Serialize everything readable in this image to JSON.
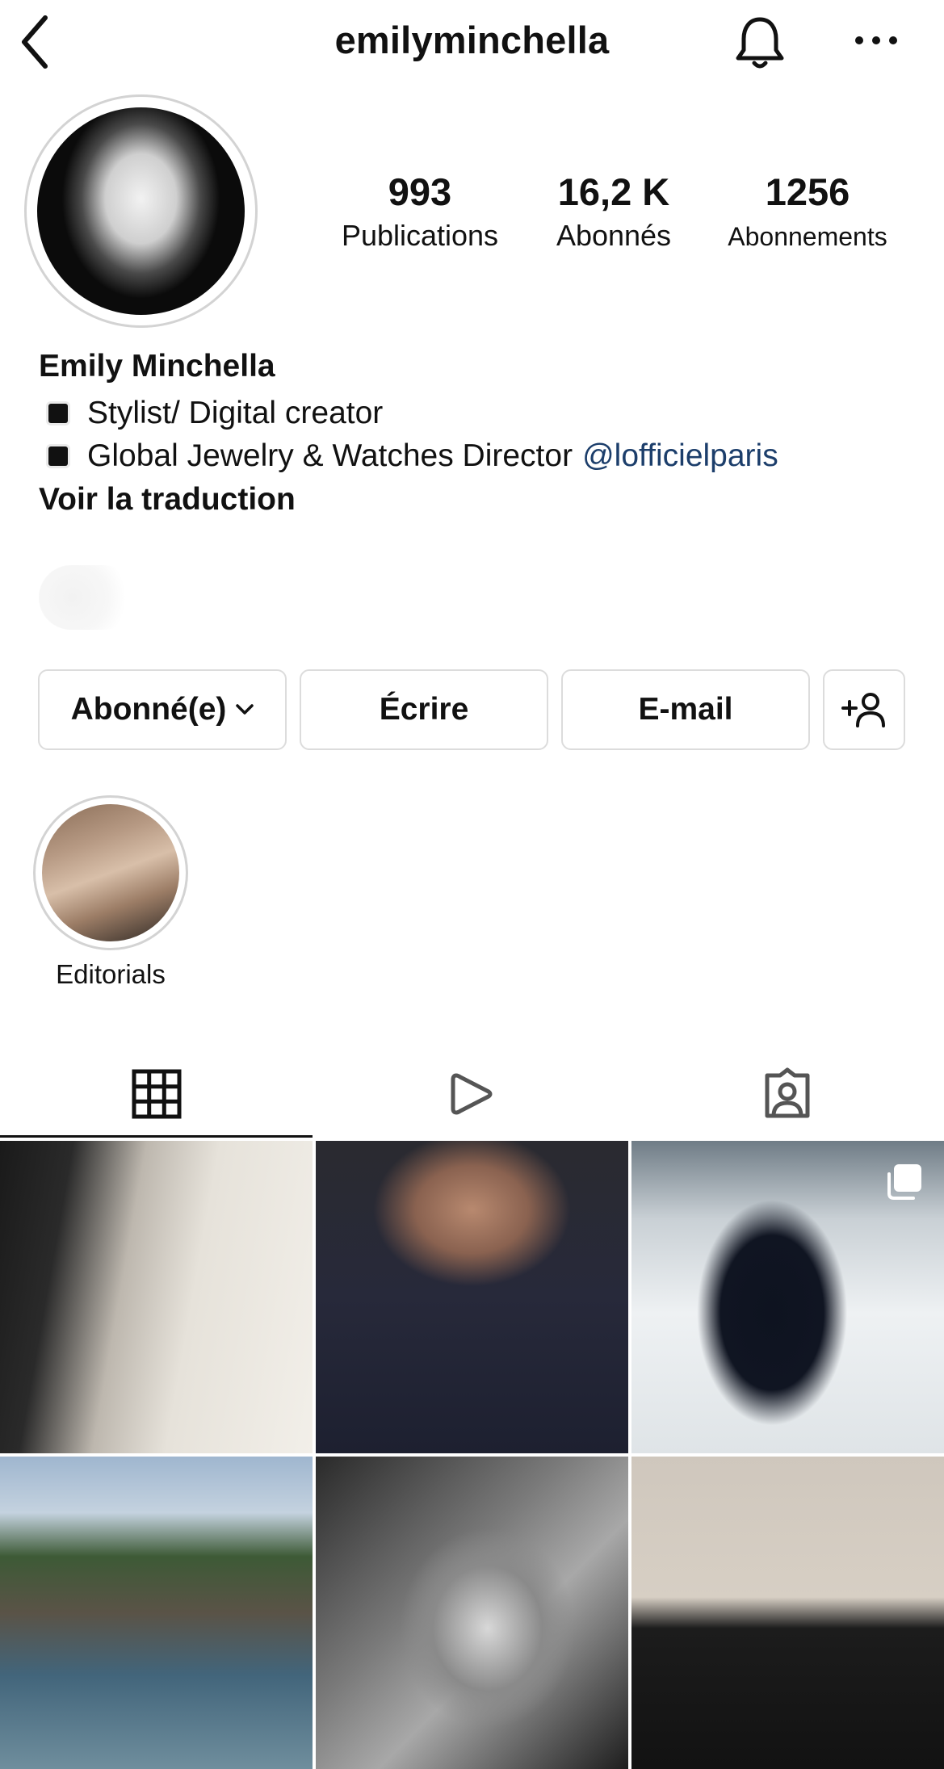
{
  "header": {
    "username": "emilyminchella"
  },
  "stats": {
    "posts": {
      "value": "993",
      "label": "Publications"
    },
    "followers": {
      "value": "16,2 K",
      "label": "Abonnés"
    },
    "following": {
      "value": "1256",
      "label": "Abonnements"
    }
  },
  "bio": {
    "name": "Emily Minchella",
    "line1": "Stylist/ Digital creator",
    "line2": "Global Jewelry & Watches Director",
    "mention": "@lofficielparis",
    "translate": "Voir la traduction"
  },
  "buttons": {
    "following": "Abonné(e)",
    "message": "Écrire",
    "email": "E-mail"
  },
  "highlights": [
    {
      "label": "Editorials"
    }
  ],
  "tabs": [
    "grid",
    "reels",
    "tagged"
  ],
  "icons": {
    "back": "chevron-left-icon",
    "notifications": "bell-icon",
    "more": "more-horizontal-icon",
    "add_user": "add-user-icon",
    "carousel": "multiple-posts-icon"
  },
  "colors": {
    "mention": "#1c3e6b",
    "border": "#dcdcdc",
    "text": "#111111"
  }
}
